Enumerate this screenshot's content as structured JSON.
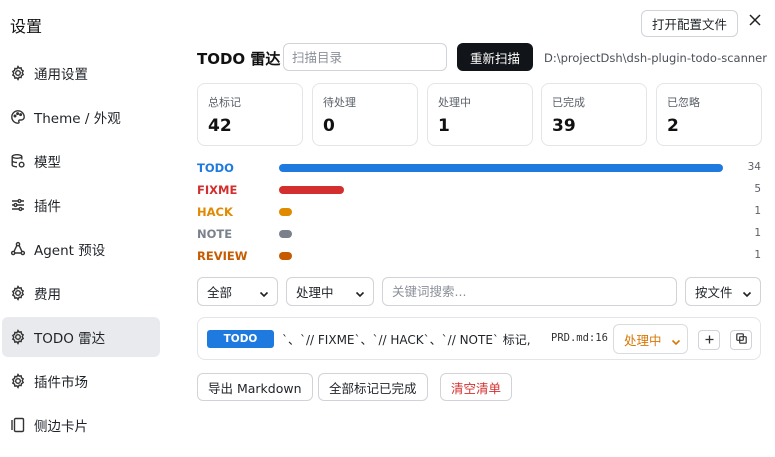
{
  "app": {
    "title": "设置"
  },
  "sidebar": {
    "items": [
      {
        "label": "通用设置",
        "icon": "gear-icon"
      },
      {
        "label": "Theme / 外观",
        "icon": "palette-icon"
      },
      {
        "label": "模型",
        "icon": "database-icon"
      },
      {
        "label": "插件",
        "icon": "sliders-icon"
      },
      {
        "label": "Agent 预设",
        "icon": "agent-icon"
      },
      {
        "label": "费用",
        "icon": "gear-icon"
      },
      {
        "label": "TODO 雷达",
        "icon": "gear-icon",
        "active": true
      },
      {
        "label": "插件市场",
        "icon": "gear-icon"
      },
      {
        "label": "侧边卡片",
        "icon": "card-icon"
      }
    ]
  },
  "header": {
    "open_config_label": "打开配置文件",
    "title": "TODO 雷达",
    "scan_placeholder": "扫描目录",
    "rescan_label": "重新扫描",
    "path": "D:\\projectDsh\\dsh-plugin-todo-scanner"
  },
  "stats": [
    {
      "label": "总标记",
      "value": "42"
    },
    {
      "label": "待处理",
      "value": "0"
    },
    {
      "label": "处理中",
      "value": "1"
    },
    {
      "label": "已完成",
      "value": "39"
    },
    {
      "label": "已忽略",
      "value": "2"
    }
  ],
  "tag_counts": [
    {
      "label": "TODO",
      "count": 34,
      "color": "#1f7ae0"
    },
    {
      "label": "FIXME",
      "count": 5,
      "color": "#d32f2f"
    },
    {
      "label": "HACK",
      "count": 1,
      "color": "#e08a00"
    },
    {
      "label": "NOTE",
      "count": 1,
      "color": "#7b818c"
    },
    {
      "label": "REVIEW",
      "count": 1,
      "color": "#c75b00"
    }
  ],
  "filters": {
    "scope": "全部",
    "status": "处理中",
    "keyword_placeholder": "关键词搜索...",
    "group_by": "按文件"
  },
  "item": {
    "tag": "TODO",
    "text": "`、`// FIXME`、`// HACK`、`// NOTE` 标记,",
    "file": "PRD.md:16",
    "status": "处理中"
  },
  "actions": {
    "export_label": "导出 Markdown",
    "complete_all_label": "全部标记已完成",
    "clear_label": "清空清单"
  }
}
